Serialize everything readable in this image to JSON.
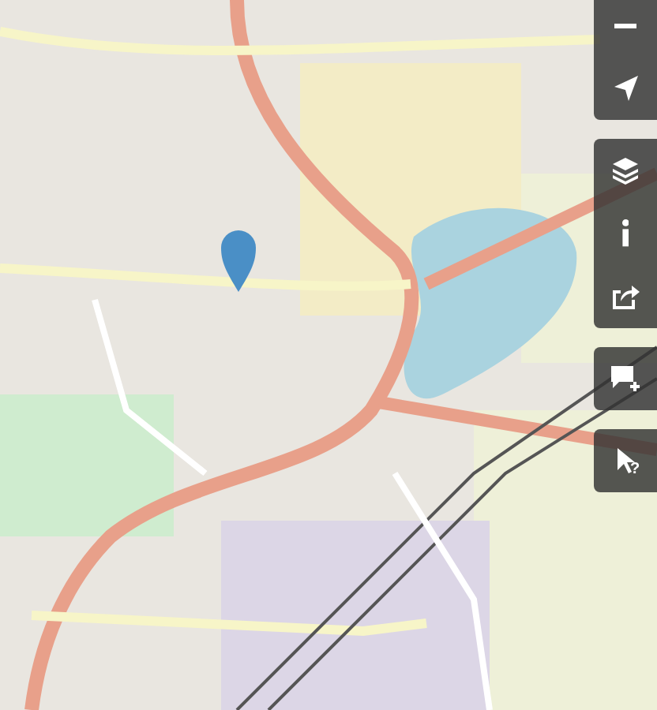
{
  "map": {
    "marker": true
  },
  "control_groups": [
    {
      "buttons": [
        {
          "kind": "zoom-out"
        },
        {
          "kind": "locate"
        }
      ]
    },
    {
      "buttons": [
        {
          "kind": "layers"
        },
        {
          "kind": "info"
        },
        {
          "kind": "share"
        }
      ]
    },
    {
      "buttons": [
        {
          "kind": "note"
        }
      ]
    },
    {
      "buttons": [
        {
          "kind": "query",
          "glyph": "?"
        }
      ]
    }
  ]
}
